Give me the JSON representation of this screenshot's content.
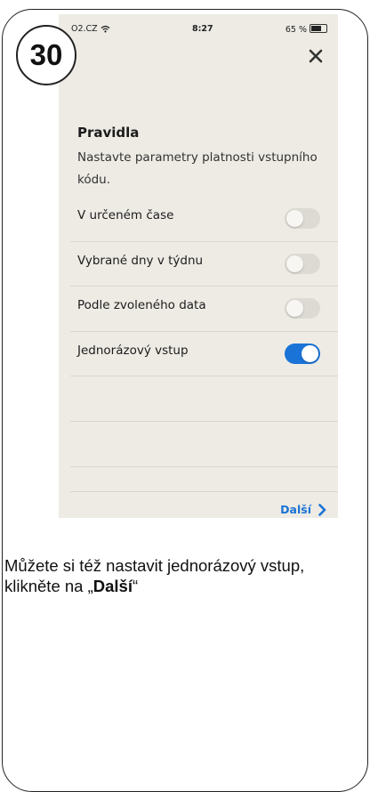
{
  "step_number": "30",
  "status_bar": {
    "carrier": "O2.CZ",
    "time": "8:27",
    "battery": "65 %"
  },
  "screen": {
    "title": "Pravidla",
    "description": "Nastavte parametry platnosti vstupního kódu.",
    "rules": [
      {
        "label": "V určeném čase",
        "enabled": false
      },
      {
        "label": "Vybrané dny v týdnu",
        "enabled": false
      },
      {
        "label": "Podle zvoleného data",
        "enabled": false
      },
      {
        "label": "Jednorázový vstup",
        "enabled": true
      }
    ],
    "next_label": "Další"
  },
  "caption": {
    "text_before": "Můžete si též nastavit jednorázový vstup, klikněte na „",
    "bold": "Další",
    "text_after": "“"
  },
  "colors": {
    "accent": "#1a73d6",
    "screen_bg": "#edebe4"
  }
}
